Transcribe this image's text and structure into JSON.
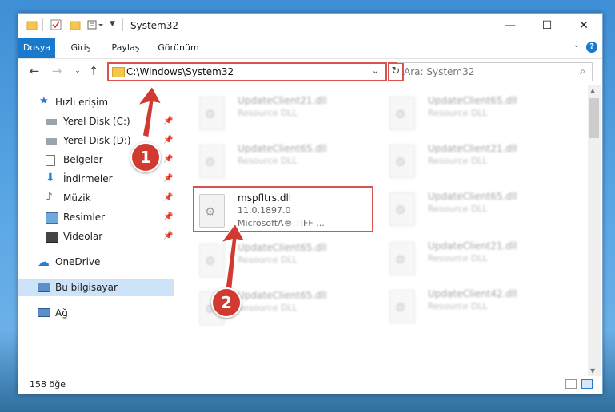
{
  "window": {
    "title": "System32",
    "controls": {
      "minimize": "—",
      "maximize": "☐",
      "close": "✕"
    }
  },
  "ribbon": {
    "tabs": [
      "Dosya",
      "Giriş",
      "Paylaş",
      "Görünüm"
    ],
    "active_tab": "Dosya",
    "help": "?"
  },
  "address": {
    "path": "C:\\Windows\\System32",
    "search_placeholder": "Ara: System32"
  },
  "sidebar": {
    "items": [
      {
        "label": "Hızlı erişim",
        "icon": "star-icon",
        "pinned": false
      },
      {
        "label": "Yerel Disk (C:)",
        "icon": "drive-icon",
        "pinned": true
      },
      {
        "label": "Yerel Disk (D:)",
        "icon": "drive-icon",
        "pinned": true
      },
      {
        "label": "Belgeler",
        "icon": "documents-icon",
        "pinned": true
      },
      {
        "label": "İndirmeler",
        "icon": "download-icon",
        "pinned": true
      },
      {
        "label": "Müzik",
        "icon": "music-icon",
        "pinned": true
      },
      {
        "label": "Resimler",
        "icon": "pictures-icon",
        "pinned": true
      },
      {
        "label": "Videolar",
        "icon": "videos-icon",
        "pinned": true
      },
      {
        "label": "OneDrive",
        "icon": "cloud-icon",
        "pinned": false
      },
      {
        "label": "Bu bilgisayar",
        "icon": "computer-icon",
        "pinned": false,
        "selected": true
      },
      {
        "label": "Ağ",
        "icon": "network-icon",
        "pinned": false
      }
    ]
  },
  "files": [
    {
      "name": "UpdateClient21.dll",
      "type": "Resource DLL"
    },
    {
      "name": "UpdateClient65.dll",
      "type": "Resource DLL"
    },
    {
      "name": "UpdateClient65.dll",
      "type": "Resource DLL"
    },
    {
      "name": "UpdateClient21.dll",
      "type": "Resource DLL"
    },
    {
      "name": "mspfltrs.dll",
      "version": "11.0.1897.0",
      "description": "MicrosoftA® TIFF ..."
    },
    {
      "name": "UpdateClient65.dll",
      "type": "Resource DLL"
    },
    {
      "name": "UpdateClient65.dll",
      "type": "Resource DLL"
    },
    {
      "name": "UpdateClient21.dll",
      "type": "Resource DLL"
    },
    {
      "name": "UpdateClient65.dll",
      "type": "Resource DLL"
    },
    {
      "name": "UpdateClient42.dll",
      "type": "Resource DLL"
    }
  ],
  "status": {
    "item_count": "158 öğe"
  },
  "annotations": {
    "step1": "1",
    "step2": "2",
    "color": "#d13a30"
  }
}
